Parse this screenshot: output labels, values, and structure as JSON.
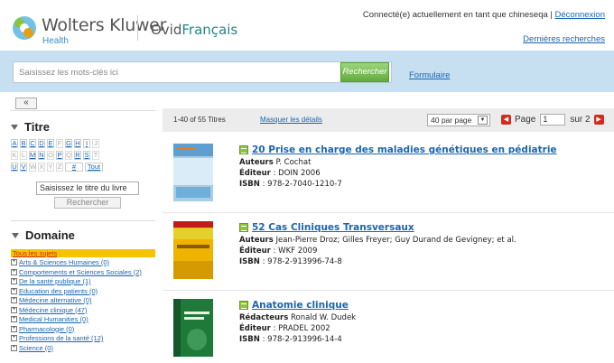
{
  "header": {
    "logo_text": "Wolters Kluwer",
    "logo_sub": "Health",
    "brand_prefix": "Ovid",
    "brand_accent": "Français",
    "connected_text": "Connecté(e) actuellement en tant que chineseqa | ",
    "logout_link": "Déconnexion",
    "recent_link": "Dernières recherches"
  },
  "search": {
    "placeholder": "Saisissez les mots-clés ici",
    "button_label": "Rechercher",
    "form_link": "Formulaire"
  },
  "sidebar": {
    "collapse_label": "«",
    "titre": {
      "heading": "Titre",
      "rows": [
        [
          {
            "l": "A",
            "on": true
          },
          {
            "l": "B",
            "on": true
          },
          {
            "l": "C",
            "on": true
          },
          {
            "l": "D",
            "on": true
          },
          {
            "l": "E",
            "on": true
          },
          {
            "l": "F",
            "on": false
          },
          {
            "l": "G",
            "on": true
          },
          {
            "l": "H",
            "on": true
          },
          {
            "l": "I",
            "on": true
          },
          {
            "l": "J",
            "on": false
          }
        ],
        [
          {
            "l": "K",
            "on": false
          },
          {
            "l": "L",
            "on": false
          },
          {
            "l": "M",
            "on": true
          },
          {
            "l": "N",
            "on": true
          },
          {
            "l": "O",
            "on": false
          },
          {
            "l": "P",
            "on": true
          },
          {
            "l": "Q",
            "on": false
          },
          {
            "l": "R",
            "on": true
          },
          {
            "l": "S",
            "on": true
          },
          {
            "l": "T",
            "on": false
          }
        ],
        [
          {
            "l": "U",
            "on": true
          },
          {
            "l": "V",
            "on": true
          },
          {
            "l": "W",
            "on": false
          },
          {
            "l": "X",
            "on": false
          },
          {
            "l": "Y",
            "on": false
          },
          {
            "l": "Z",
            "on": false
          },
          {
            "l": "#",
            "on": true
          },
          {
            "l": "Tout",
            "on": true
          }
        ]
      ],
      "book_input_value": "Saisissez le titre du livre",
      "book_button": "Rechercher"
    },
    "domaine": {
      "heading": "Domaine",
      "all_subjects": "Tous les sujets",
      "items": [
        "Arts & Sciences Humaines (0)",
        "Comportements et Sciences Sociales (2)",
        "De la santé publique (1)",
        "Education des patients (0)",
        "Médecine alternative (0)",
        "Médecine clinique (47)",
        "Medical Humanities (0)",
        "Pharmacologie (0)",
        "Professions de la santé (12)",
        "Science (0)"
      ]
    }
  },
  "results": {
    "count": "1-40 of 55 Titres",
    "hide_details": "Masquer les détails",
    "per_page": "40 par page",
    "page_label": "Page",
    "page_value": "1",
    "of_label": "sur 2",
    "items": [
      {
        "title": "20 Prise en charge des maladies génétiques en pédiatrie",
        "role": "Auteurs",
        "people": "P. Cochat",
        "editor_label": "Éditeur",
        "editor": "DOIN 2006",
        "isbn_label": "ISBN",
        "isbn": "978-2-7040-1210-7",
        "cover_text": "Prise en charge des maladies génétiques en pédiatrie"
      },
      {
        "title": "52 Cas Cliniques Transversaux",
        "role": "Auteurs",
        "people": "Jean-Pierre Droz; Gilles Freyer; Guy Durand de Gevigney; et al.",
        "editor_label": "Éditeur",
        "editor": "WKF 2009",
        "isbn_label": "ISBN",
        "isbn": "978-2-913996-74-8",
        "cover_text": "52 cas cliniques transversaux"
      },
      {
        "title": "Anatomie clinique",
        "role": "Rédacteurs",
        "people": "Ronald W. Dudek",
        "editor_label": "Éditeur",
        "editor": "PRADEL 2002",
        "isbn_label": "ISBN",
        "isbn": "978-2-913996-14-4",
        "cover_text": "Anatomie clinique"
      }
    ]
  },
  "colors": {
    "search_bar": "#c6dff1",
    "link": "#1a66b3",
    "search_button": "#62ac3a",
    "highlight": "#f5c400",
    "nav_red": "#d52b1e"
  }
}
